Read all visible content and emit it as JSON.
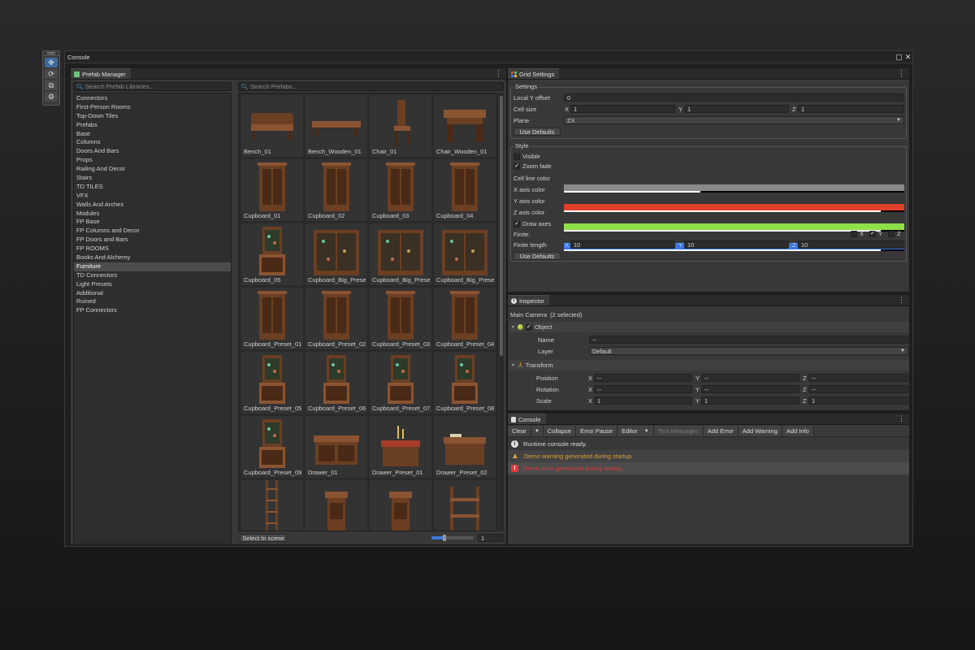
{
  "window": {
    "title": "Console"
  },
  "prefab_manager": {
    "tab_label": "Prefab Manager",
    "library_search_placeholder": "Search Prefab Libraries...",
    "prefab_search_placeholder": "Search Prefabs...",
    "libraries": [
      "Connectors",
      "First-Person Rooms",
      "Top-Down Tiles",
      "Prefabs",
      "Base",
      "Columns",
      "Doors And Bars",
      "Props",
      "Railing And Decor",
      "Stairs",
      "TD TILES",
      "VFX",
      "Walls And Arches",
      "Modules",
      "FP Base",
      "FP Columns and Decor",
      "FP Doors and Bars",
      "FP ROOMS",
      "Books And Alchemy",
      "Furniture",
      "TD Connectors",
      "Light Presets",
      "Additional",
      "Ruined",
      "FP Connectors"
    ],
    "selected_library": "Furniture",
    "prefabs": [
      "Bench_01",
      "Bench_Wooden_01",
      "Chair_01",
      "Chair_Wooden_01",
      "Cupboard_01",
      "Cupboard_02",
      "Cupboard_03",
      "Cupboard_04",
      "Cupboard_05",
      "Cupboard_Big_Preset_",
      "Cupboard_Big_Preset_",
      "Cupboard_Big_Preset_",
      "Cupboard_Preset_01",
      "Cupboard_Preset_02",
      "Cupboard_Preset_03",
      "Cupboard_Preset_04",
      "Cupboard_Preset_05",
      "Cupboard_Preset_06",
      "Cupboard_Preset_07",
      "Cupboard_Preset_08",
      "Cupboard_Preset_09",
      "Drawer_01",
      "Drawer_Preset_01",
      "Drawer_Preset_02",
      "",
      "",
      "",
      ""
    ],
    "select_in_scene_label": "Select In scene",
    "zoom_value": "1",
    "zoom_level": 0.3
  },
  "grid_settings": {
    "tab_label": "Grid Settings",
    "settings_label": "Settings",
    "local_y_offset_label": "Local Y offset",
    "local_y_offset": "0",
    "cell_size_label": "Cell size",
    "cell_size": {
      "x": "1",
      "y": "1",
      "z": "1"
    },
    "plane_label": "Plane",
    "plane": "ZX",
    "use_defaults_label": "Use Defaults",
    "style_label": "Style",
    "visible_label": "Visible",
    "visible": false,
    "zoom_fade_label": "Zoom fade",
    "zoom_fade": true,
    "cell_line_color_label": "Cell line color",
    "cell_line_color": "#8a8a8a",
    "cell_line_alpha": 0.4,
    "x_axis_color_label": "X axis color",
    "x_axis_color": "#e0402a",
    "x_axis_alpha": 0.93,
    "y_axis_color_label": "Y axis color",
    "y_axis_color": "#8ee04a",
    "y_axis_alpha": 0.93,
    "z_axis_color_label": "Z axis color",
    "z_axis_color": "#3a78e8",
    "z_axis_alpha": 0.93,
    "draw_axes_label": "Draw axes",
    "draw_axes": true,
    "finite_label": "Finite:",
    "finite": {
      "x": false,
      "y": true,
      "z": false
    },
    "finite_length_label": "Finite length",
    "finite_length": {
      "x": "10",
      "y": "10",
      "z": "10"
    },
    "axis_letters": {
      "x": "X",
      "y": "Y",
      "z": "Z"
    }
  },
  "inspector": {
    "tab_label": "Inspector",
    "header": "Main Camera  (2 selected)",
    "object_label": "Object",
    "name_label": "Name",
    "name_value": "--",
    "layer_label": "Layer",
    "layer_value": "Default",
    "transform_label": "Transform",
    "position_label": "Position",
    "position": {
      "x": "--",
      "y": "--",
      "z": "--"
    },
    "rotation_label": "Rotation",
    "rotation": {
      "x": "--",
      "y": "--",
      "z": "--"
    },
    "scale_label": "Scale",
    "scale": {
      "x": "1",
      "y": "1",
      "z": "1"
    }
  },
  "console": {
    "tab_label": "Console",
    "toolbar": {
      "clear": "Clear",
      "collapse": "Collapse",
      "error_pause": "Error Pause",
      "editor": "Editor",
      "test_messages": "Test Messages",
      "add_error": "Add Error",
      "add_warning": "Add Warning",
      "add_info": "Add Info"
    },
    "logs": [
      {
        "type": "info",
        "text": "Runtime console ready."
      },
      {
        "type": "warning",
        "text": "Demo warning generated during startup."
      },
      {
        "type": "error",
        "text": "Demo error generated during startup."
      }
    ]
  },
  "colors": {
    "accent": "#3d6a9e",
    "warning": "#d9a03c",
    "error": "#e03a3a",
    "info": "#5aa0e8"
  }
}
